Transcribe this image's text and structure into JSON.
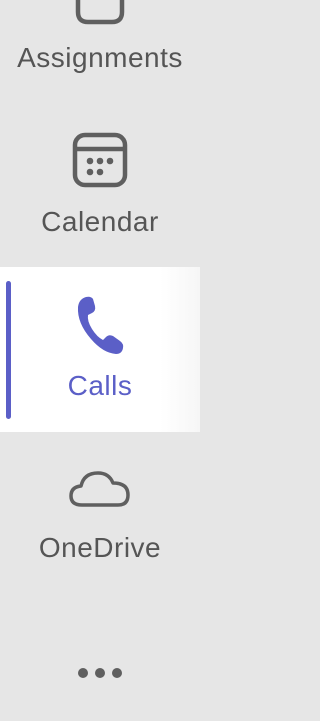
{
  "app_rail": {
    "items": [
      {
        "label": "Assignments",
        "icon": "assignments-icon",
        "active": false
      },
      {
        "label": "Calendar",
        "icon": "calendar-icon",
        "active": false
      },
      {
        "label": "Calls",
        "icon": "phone-icon",
        "active": true
      },
      {
        "label": "OneDrive",
        "icon": "cloud-icon",
        "active": false
      }
    ],
    "more": {
      "icon": "more-icon"
    }
  },
  "colors": {
    "rail_background": "#e6e6e6",
    "active_background": "#ffffff",
    "accent": "#5b5fc7",
    "text": "#555555",
    "icon": "#5f5f5f"
  }
}
